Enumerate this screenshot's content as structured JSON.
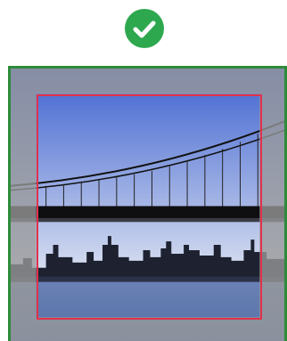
{
  "status": {
    "icon": "check-circle-icon",
    "color": "#2ea84f"
  },
  "image": {
    "subject": "bridge-and-city-skyline-photo",
    "frame_color": "#2e8b3a"
  },
  "selection": {
    "color": "#e0314b"
  },
  "palette": {
    "sky_top": "#3f63d0",
    "sky_bottom": "#d7def0",
    "water": "#5570a8",
    "overlay": "#9a9a9a"
  }
}
